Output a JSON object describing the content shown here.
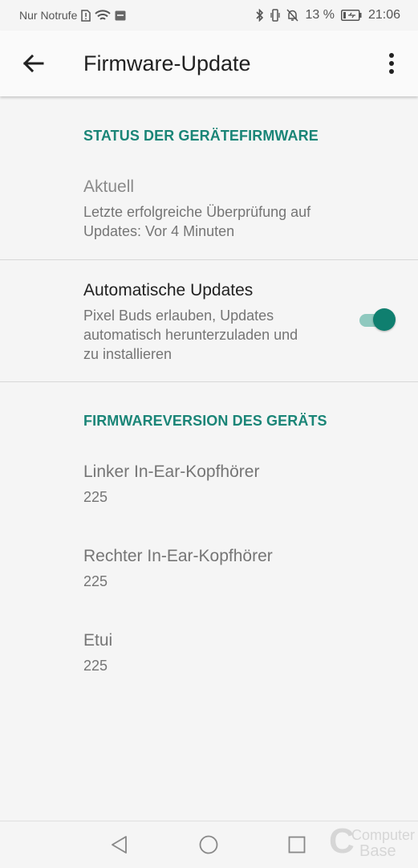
{
  "status_bar": {
    "carrier": "Nur Notrufe",
    "battery": "13 %",
    "time": "21:06",
    "icons": [
      "sim-alert-icon",
      "wifi-icon",
      "sim-icon",
      "bluetooth-icon",
      "vibrate-icon",
      "bell-off-icon",
      "battery-icon"
    ]
  },
  "app_bar": {
    "title": "Firmware-Update",
    "icons": [
      "back-arrow-icon",
      "more-vert-icon"
    ]
  },
  "status_section": {
    "header": "STATUS DER GERÄTEFIRMWARE",
    "current": {
      "title": "Aktuell",
      "line1": "Letzte erfolgreiche Überprüfung auf",
      "line2": "Updates: Vor 4 Minuten"
    },
    "auto_updates": {
      "title": "Automatische Updates",
      "line1": "Pixel Buds erlauben, Updates",
      "line2": "automatisch herunterzuladen und",
      "line3": "zu installieren",
      "enabled": true
    }
  },
  "version_section": {
    "header": "FIRMWAREVERSION DES GERÄTS",
    "left": {
      "title": "Linker In-Ear-Kopfhörer",
      "value": "225"
    },
    "right": {
      "title": "Rechter In-Ear-Kopfhörer",
      "value": "225"
    },
    "case": {
      "title": "Etui",
      "value": "225"
    }
  },
  "nav_bar": {
    "icons": [
      "back-triangle-icon",
      "home-circle-icon",
      "recents-square-icon"
    ]
  },
  "watermark": {
    "line1": "Computer",
    "line2": "Base"
  },
  "colors": {
    "accent": "#1a8577",
    "toggle_thumb": "#0f7f6f",
    "toggle_track": "#8fc9bf",
    "background": "#f5f5f5"
  }
}
